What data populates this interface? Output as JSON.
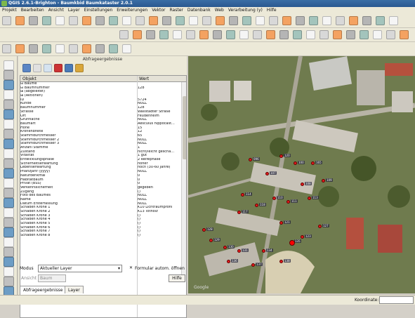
{
  "window": {
    "title": "QGIS 2.6.1-Brighton - Baumkbid Baumkataster 2.0.1"
  },
  "menu": [
    "Projekt",
    "Bearbeiten",
    "Ansicht",
    "Layer",
    "Einstellungen",
    "Erweiterungen",
    "Vektor",
    "Raster",
    "Datenbank",
    "Web",
    "Verarbeitung (y)",
    "Hilfe"
  ],
  "panel": {
    "title": "Abfrageergebnisse",
    "columns": {
      "object": "Objekt",
      "value": "Wert"
    },
    "rows": [
      {
        "k": "⊟ Baume",
        "v": ""
      },
      {
        "k": "   ⊟ Baumnummer",
        "v": "128"
      },
      {
        "k": "      ⊞ (abgeleitet)",
        "v": ""
      },
      {
        "k": "      ⊞ (Aktionen)",
        "v": ""
      },
      {
        "k": "        ID",
        "v": "5724"
      },
      {
        "k": "        Kunde",
        "v": "NULL"
      },
      {
        "k": "        Baumnummer",
        "v": "128"
      },
      {
        "k": "        Strasse",
        "v": "Wallstadter Straße"
      },
      {
        "k": "        Ort",
        "v": "Feudenheim"
      },
      {
        "k": "        Grünfläche",
        "v": "NULL"
      },
      {
        "k": "        Baumart",
        "v": "Aesculus hippocast..."
      },
      {
        "k": "        Höhe",
        "v": "15"
      },
      {
        "k": "        Kronenbreite",
        "v": "12"
      },
      {
        "k": "        Stammdurchmesser",
        "v": "65"
      },
      {
        "k": "        Stammdurchmesser 2",
        "v": "NULL"
      },
      {
        "k": "        Stammdurchmesser 3",
        "v": "NULL"
      },
      {
        "k": "        Anzahl Stämme",
        "v": "1"
      },
      {
        "k": "        Zustand",
        "v": "nicht/leicht gescha..."
      },
      {
        "k": "        Vitalität",
        "v": "1 gut"
      },
      {
        "k": "        Entwicklungsphase",
        "v": "2 Reifephase"
      },
      {
        "k": "        Sicherheitserwartung",
        "v": "höher"
      },
      {
        "k": "        Lebenserwartung",
        "v": "hoch (30-60 Jahre)"
      },
      {
        "k": "        Pflanzjahr (yyyy)",
        "v": "NULL"
      },
      {
        "k": "        Naturdenkmal",
        "v": "0"
      },
      {
        "k": "        Habitatbaum",
        "v": "0"
      },
      {
        "k": "        Privat (BSS)",
        "v": "0"
      },
      {
        "k": "        Verkehrssicherheit",
        "v": "gegeben"
      },
      {
        "k": "        Zugang",
        "v": "()"
      },
      {
        "k": "        Foto des Baumes",
        "v": "NULL"
      },
      {
        "k": "        Name",
        "v": "NULL"
      },
      {
        "k": "        Datum Ersterfassung",
        "v": "NULL"
      },
      {
        "k": "        Schaden Krone 1",
        "v": "K10 Lichtraumprofil"
      },
      {
        "k": "        Schaden Krone 2",
        "v": "K13 Totholz"
      },
      {
        "k": "        Schaden Krone 3",
        "v": "()"
      },
      {
        "k": "        Schaden Krone 4",
        "v": "()"
      },
      {
        "k": "        Schaden Krone 5",
        "v": "()"
      },
      {
        "k": "        Schaden Krone 6",
        "v": "()"
      },
      {
        "k": "        Schaden Krone 7",
        "v": "()"
      },
      {
        "k": "        Schaden Krone 8",
        "v": "()"
      }
    ],
    "mode_label": "Modus",
    "mode_value": "Aktueller Layer",
    "auto_open": "Formular autom. öffnen",
    "ansicht_label": "Ansicht",
    "ansicht_value": "Baum",
    "help": "Hilfe",
    "tabs": [
      "Abfrageergebnisse",
      "Layer"
    ]
  },
  "map": {
    "labels": [
      "096",
      "120",
      "100",
      "165",
      "107",
      "108",
      "109",
      "110",
      "111",
      "113",
      "114",
      "117",
      "118",
      "121",
      "123",
      "127",
      "128",
      "129",
      "130",
      "131",
      "134",
      "135",
      "136",
      "137",
      "138"
    ],
    "watermark": "Google"
  },
  "status": {
    "coord_label": "Koordinate:"
  }
}
